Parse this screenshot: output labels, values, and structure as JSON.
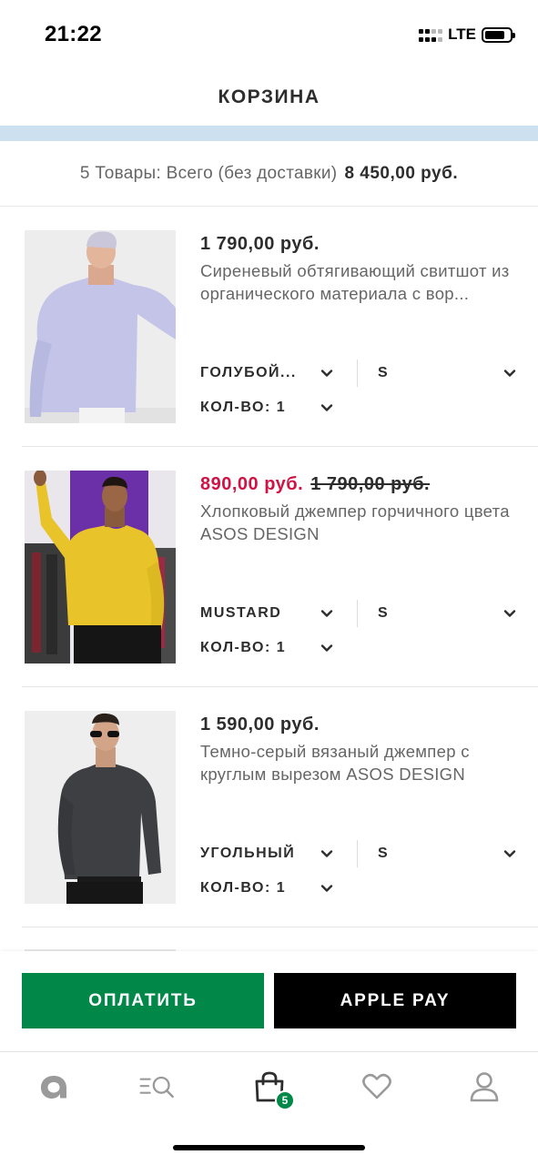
{
  "status": {
    "time": "21:22",
    "network": "LTE",
    "battery_percent": 80
  },
  "header": {
    "title": "КОРЗИНА"
  },
  "summary": {
    "label": "5 Товары: Всего (без доставки)",
    "total": "8 450,00 руб."
  },
  "items": [
    {
      "price": "1 790,00 руб.",
      "old_price": "",
      "description": "Сиреневый обтягивающий свитшот из органического материала с вор...",
      "color": "ГОЛУБОЙ...",
      "size": "S",
      "qty": "КОЛ-ВО: 1"
    },
    {
      "price": "890,00 руб.",
      "old_price": "1 790,00 руб.",
      "description": "Хлопковый джемпер горчичного цвета ASOS DESIGN",
      "color": "MUSTARD",
      "size": "S",
      "qty": "КОЛ-ВО: 1"
    },
    {
      "price": "1 590,00 руб.",
      "old_price": "",
      "description": "Темно-серый вязаный джемпер с круглым вырезом ASOS DESIGN",
      "color": "УГОЛЬНЫЙ",
      "size": "S",
      "qty": "КОЛ-ВО: 1"
    }
  ],
  "actions": {
    "pay": "ОПЛАТИТЬ",
    "apple_pay": "APPLE PAY"
  },
  "tabbar": {
    "bag_count": "5"
  },
  "colors": {
    "accent_green": "#018849",
    "sale_red": "#d01345",
    "strip_blue": "#cde0f0"
  }
}
